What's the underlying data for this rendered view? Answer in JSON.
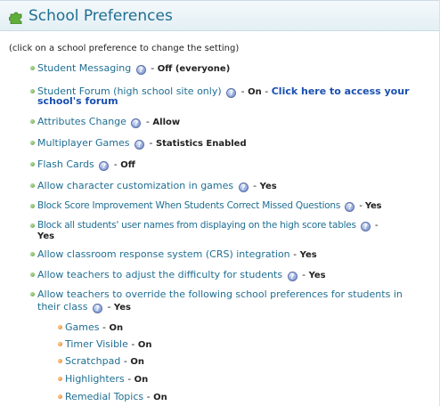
{
  "header": {
    "title": "School Preferences",
    "icon": "puzzle-piece-icon"
  },
  "note": "(click on a school preference to change the setting)",
  "separator": "-",
  "help_glyph": "?",
  "prefs": [
    {
      "label": "Student Messaging",
      "value": "Off (everyone)"
    },
    {
      "label": "Student Forum (high school site only)",
      "value": "On",
      "extra": "Click here to access your",
      "extra2": "school's forum"
    },
    {
      "label": "Attributes Change",
      "value": "Allow"
    },
    {
      "label": "Multiplayer Games",
      "value": "Statistics Enabled"
    },
    {
      "label": "Flash Cards",
      "value": "Off"
    },
    {
      "label": "Allow character customization in games",
      "value": "Yes"
    },
    {
      "label": "Block Score Improvement When Students Correct Missed Questions",
      "value": "Yes"
    },
    {
      "label": "Block all students' user names from displaying on the high score tables",
      "value": "Yes"
    },
    {
      "label": "Allow classroom response system (CRS) integration",
      "value": "Yes"
    },
    {
      "label": "Allow teachers to adjust the difficulty for students",
      "value": "Yes"
    },
    {
      "label": "Allow teachers to override the following school preferences for students in",
      "label2": "their class",
      "value": "Yes"
    }
  ],
  "subprefs": [
    {
      "label": "Games",
      "value": "On"
    },
    {
      "label": "Timer Visible",
      "value": "On"
    },
    {
      "label": "Scratchpad",
      "value": "On"
    },
    {
      "label": "Highlighters",
      "value": "On"
    },
    {
      "label": "Remedial Topics",
      "value": "On"
    }
  ]
}
